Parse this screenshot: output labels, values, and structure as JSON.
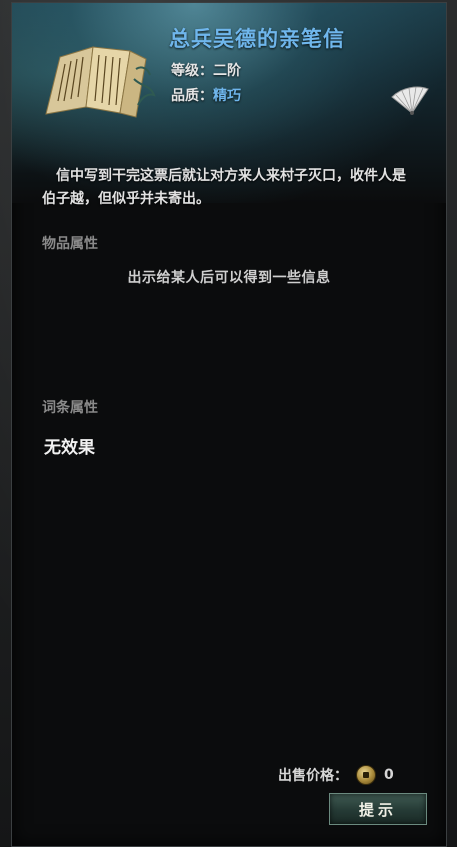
{
  "item": {
    "title": "总兵吴德的亲笔信",
    "level_label": "等级：",
    "level_value": "二阶",
    "quality_label": "品质：",
    "quality_value": "精巧",
    "description": "信中写到干完这票后就让对方来人来村子灭口，收件人是伯子越，但似乎并未寄出。"
  },
  "sections": {
    "attributes_title": "物品属性",
    "attributes_text": "出示给某人后可以得到一些信息",
    "affix_title": "词条属性",
    "affix_value": "无效果"
  },
  "footer": {
    "price_label": "出售价格：",
    "price_value": "0",
    "hint_button": "提示"
  },
  "colors": {
    "title": "#6fb6ec",
    "quality": "#6fb6ec"
  },
  "icons": [
    "letter-scroll-icon",
    "fan-icon",
    "coin-icon"
  ]
}
